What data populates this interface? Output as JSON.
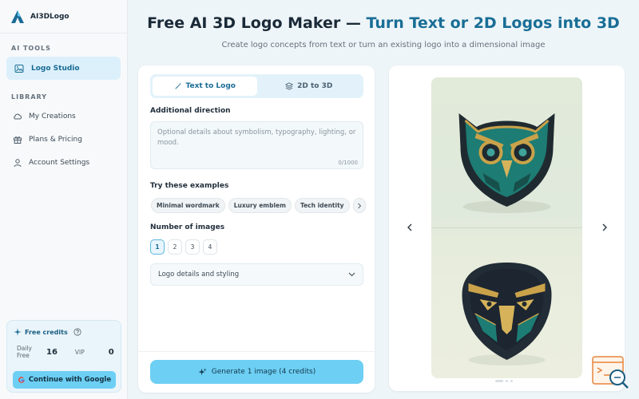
{
  "app": {
    "name": "AI3DLogo"
  },
  "sidebar": {
    "sections": [
      {
        "label": "AI TOOLS"
      },
      {
        "label": "LIBRARY"
      }
    ],
    "active_item": {
      "label": "Logo Studio",
      "icon": "image-icon"
    },
    "items": [
      {
        "label": "My Creations",
        "icon": "cloud-icon"
      },
      {
        "label": "Plans & Pricing",
        "icon": "gift-icon"
      },
      {
        "label": "Account Settings",
        "icon": "user-icon"
      }
    ],
    "credits": {
      "title": "Free credits",
      "daily_label_1": "Daily",
      "daily_label_2": "Free",
      "daily_value": "16",
      "vip_label": "VIP",
      "vip_value": "0",
      "google_button": "Continue with Google"
    }
  },
  "header": {
    "title_main": "Free AI 3D Logo Maker — ",
    "title_accent": "Turn Text or 2D Logos into 3D",
    "subtitle": "Create logo concepts from text or turn an existing logo into a dimensional image"
  },
  "panel": {
    "tabs": [
      {
        "label": "Text to Logo",
        "active": true
      },
      {
        "label": "2D to 3D",
        "active": false
      }
    ],
    "direction_label": "Additional direction",
    "direction_placeholder": "Optional details about symbolism, typography, lighting, or mood.",
    "direction_counter": "0/1000",
    "examples_label": "Try these examples",
    "examples": [
      "Minimal wordmark",
      "Luxury emblem",
      "Tech identity"
    ],
    "count_label": "Number of images",
    "counts": [
      "1",
      "2",
      "3",
      "4"
    ],
    "selected_count": "1",
    "details_select": "Logo details and styling",
    "generate_button": "Generate 1 image (4 credits)"
  },
  "preview": {
    "images": [
      {
        "subject": "teal and gold 3D owl emblem"
      },
      {
        "subject": "navy, teal and gold 3D eagle emblem"
      }
    ],
    "carousel_pages": 3,
    "active_page": 1
  },
  "colors": {
    "accent": "#196e96",
    "button": "#6dcff3",
    "active_nav_bg": "#dcf0fb",
    "help_widget": "#e8843a"
  }
}
